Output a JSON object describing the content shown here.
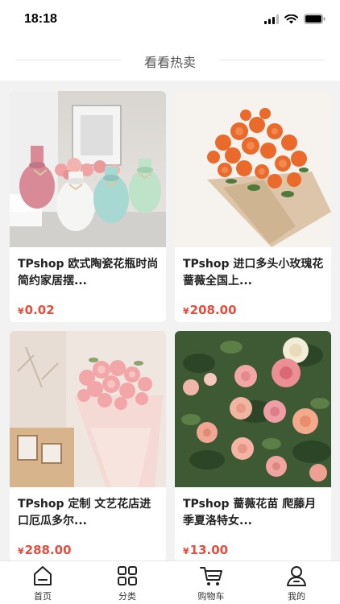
{
  "status": {
    "time": "18:18"
  },
  "section": {
    "title": "看看热卖"
  },
  "products": [
    {
      "title": "TPshop 欧式陶瓷花瓶时尚简约家居摆...",
      "currency": "¥",
      "price": "0.02"
    },
    {
      "title": "TPshop 进口多头小玫瑰花蔷薇全国上...",
      "currency": "¥",
      "price": "208.00"
    },
    {
      "title": "TPshop 定制 文艺花店进口厄瓜多尔...",
      "currency": "¥",
      "price": "288.00"
    },
    {
      "title": "TPshop 蔷薇花苗 爬藤月季夏洛特女...",
      "currency": "¥",
      "price": "13.00"
    }
  ],
  "tabbar": {
    "items": [
      {
        "label": "首页",
        "icon": "home-icon"
      },
      {
        "label": "分类",
        "icon": "category-grid-icon"
      },
      {
        "label": "购物车",
        "icon": "cart-icon"
      },
      {
        "label": "我的",
        "icon": "user-icon"
      }
    ]
  },
  "colors": {
    "price": "#e74c3c",
    "background": "#f2f2f2",
    "card": "#ffffff"
  }
}
